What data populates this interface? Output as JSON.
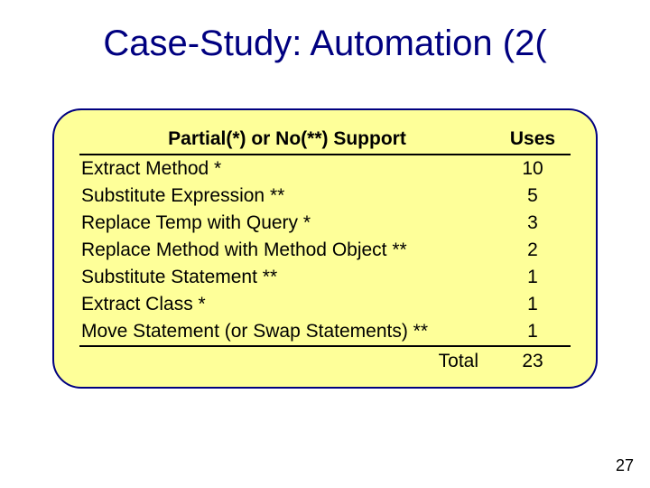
{
  "title": "Case-Study: Automation (2(",
  "table": {
    "header_left": "Partial(*) or No(**) Support",
    "header_right": "Uses",
    "rows": [
      {
        "name": "Extract Method *",
        "uses": "10"
      },
      {
        "name": "Substitute Expression **",
        "uses": "5"
      },
      {
        "name": "Replace Temp with Query *",
        "uses": "3"
      },
      {
        "name": "Replace Method with Method Object **",
        "uses": "2"
      },
      {
        "name": "Substitute Statement **",
        "uses": "1"
      },
      {
        "name": "Extract Class *",
        "uses": "1"
      },
      {
        "name": "Move Statement (or Swap Statements) **",
        "uses": "1"
      }
    ],
    "total_label": "Total",
    "total_value": "23"
  },
  "page_number": "27",
  "chart_data": {
    "type": "table",
    "title": "Case-Study: Automation (2)",
    "columns": [
      "Partial(*) or No(**) Support",
      "Uses"
    ],
    "rows": [
      [
        "Extract Method *",
        10
      ],
      [
        "Substitute Expression **",
        5
      ],
      [
        "Replace Temp with Query *",
        3
      ],
      [
        "Replace Method with Method Object **",
        2
      ],
      [
        "Substitute Statement **",
        1
      ],
      [
        "Extract Class *",
        1
      ],
      [
        "Move Statement (or Swap Statements) **",
        1
      ]
    ],
    "total": 23
  }
}
